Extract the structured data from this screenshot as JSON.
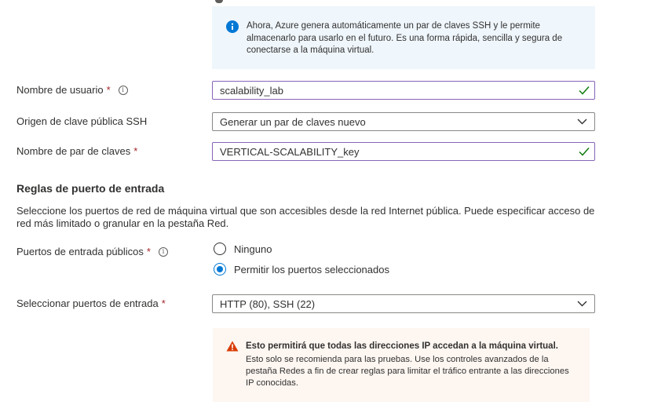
{
  "info": {
    "text": "Ahora, Azure genera automáticamente un par de claves SSH y le permite almacenarlo para usarlo en el futuro. Es una forma rápida, sencilla y segura de conectarse a la máquina virtual."
  },
  "fields": {
    "username": {
      "label": "Nombre de usuario",
      "required": "*",
      "value": "scalability_lab"
    },
    "ssh_source": {
      "label": "Origen de clave pública SSH",
      "value": "Generar un par de claves nuevo"
    },
    "key_pair_name": {
      "label": "Nombre de par de claves",
      "required": "*",
      "value": "VERTICAL-SCALABILITY_key"
    }
  },
  "inbound": {
    "title": "Reglas de puerto de entrada",
    "description": "Seleccione los puertos de red de máquina virtual que son accesibles desde la red Internet pública. Puede especificar acceso de red más limitado o granular en la pestaña Red.",
    "public_ports": {
      "label": "Puertos de entrada públicos",
      "required": "*",
      "options": [
        "Ninguno",
        "Permitir los puertos seleccionados"
      ],
      "selected": "Permitir los puertos seleccionados"
    },
    "select_ports": {
      "label": "Seleccionar puertos de entrada",
      "required": "*",
      "value": "HTTP (80), SSH (22)"
    }
  },
  "warning": {
    "title": "Esto permitirá que todas las direcciones IP accedan a la máquina virtual.",
    "text": "Esto solo se recomienda para las pruebas.  Use los controles avanzados de la pestaña Redes a fin de crear reglas para limitar el tráfico entrante a las direcciones IP conocidas."
  },
  "colors": {
    "accent": "#0078d4",
    "valid": "#107c10",
    "required": "#a4262c",
    "warning": "#d83b01",
    "info_bg": "#eff6fc",
    "warning_bg": "#fdf6f1"
  }
}
